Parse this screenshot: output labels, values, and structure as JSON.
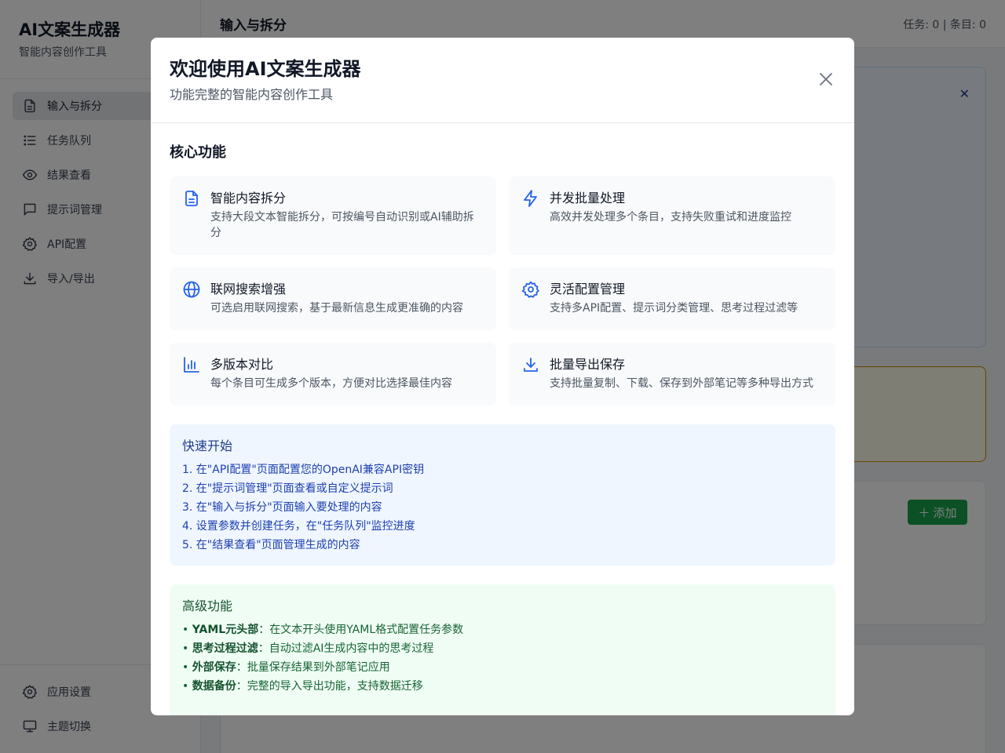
{
  "app": {
    "title": "AI文案生成器",
    "subtitle": "智能内容创作工具"
  },
  "sidebar": {
    "items": [
      {
        "label": "输入与拆分",
        "icon": "document-icon",
        "active": true
      },
      {
        "label": "任务队列",
        "icon": "list-icon",
        "active": false
      },
      {
        "label": "结果查看",
        "icon": "eye-icon",
        "active": false
      },
      {
        "label": "提示词管理",
        "icon": "chat-icon",
        "active": false
      },
      {
        "label": "API配置",
        "icon": "gear-icon",
        "active": false
      },
      {
        "label": "导入/导出",
        "icon": "download-icon",
        "active": false
      }
    ],
    "bottom": [
      {
        "label": "应用设置",
        "icon": "gear-icon"
      },
      {
        "label": "主题切换",
        "icon": "monitor-icon"
      }
    ]
  },
  "header": {
    "title": "输入与拆分",
    "stats": "任务: 0 | 条目: 0"
  },
  "background": {
    "add_label": "添加"
  },
  "modal": {
    "title": "欢迎使用AI文案生成器",
    "subtitle": "功能完整的智能内容创作工具",
    "core_title": "核心功能",
    "features": [
      {
        "title": "智能内容拆分",
        "desc": "支持大段文本智能拆分，可按编号自动识别或AI辅助拆分",
        "icon": "document-icon"
      },
      {
        "title": "并发批量处理",
        "desc": "高效并发处理多个条目，支持失败重试和进度监控",
        "icon": "lightning-icon"
      },
      {
        "title": "联网搜索增强",
        "desc": "可选启用联网搜索，基于最新信息生成更准确的内容",
        "icon": "globe-icon"
      },
      {
        "title": "灵活配置管理",
        "desc": "支持多API配置、提示词分类管理、思考过程过滤等",
        "icon": "gear-icon"
      },
      {
        "title": "多版本对比",
        "desc": "每个条目可生成多个版本，方便对比选择最佳内容",
        "icon": "bar-chart-icon"
      },
      {
        "title": "批量导出保存",
        "desc": "支持批量复制、下载、保存到外部笔记等多种导出方式",
        "icon": "download-icon"
      }
    ],
    "quick_title": "快速开始",
    "quick_steps": [
      "1. 在\"API配置\"页面配置您的OpenAI兼容API密钥",
      "2. 在\"提示词管理\"页面查看或自定义提示词",
      "3. 在\"输入与拆分\"页面输入要处理的内容",
      "4. 设置参数并创建任务，在\"任务队列\"监控进度",
      "5. 在\"结果查看\"页面管理生成的内容"
    ],
    "adv_title": "高级功能",
    "adv_items": [
      {
        "bullet": "• ",
        "name": "YAML元头部",
        "desc": "：在文本开头使用YAML格式配置任务参数"
      },
      {
        "bullet": "• ",
        "name": "思考过程过滤",
        "desc": "：自动过滤AI生成内容中的思考过程"
      },
      {
        "bullet": "• ",
        "name": "外部保存",
        "desc": "：批量保存结果到外部笔记应用"
      },
      {
        "bullet": "• ",
        "name": "数据备份",
        "desc": "：完整的导入导出功能，支持数据迁移"
      }
    ]
  },
  "colors": {
    "accent_blue": "#2563eb",
    "accent_green": "#16a34a",
    "overlay": "rgba(0,0,0,0.5)"
  }
}
